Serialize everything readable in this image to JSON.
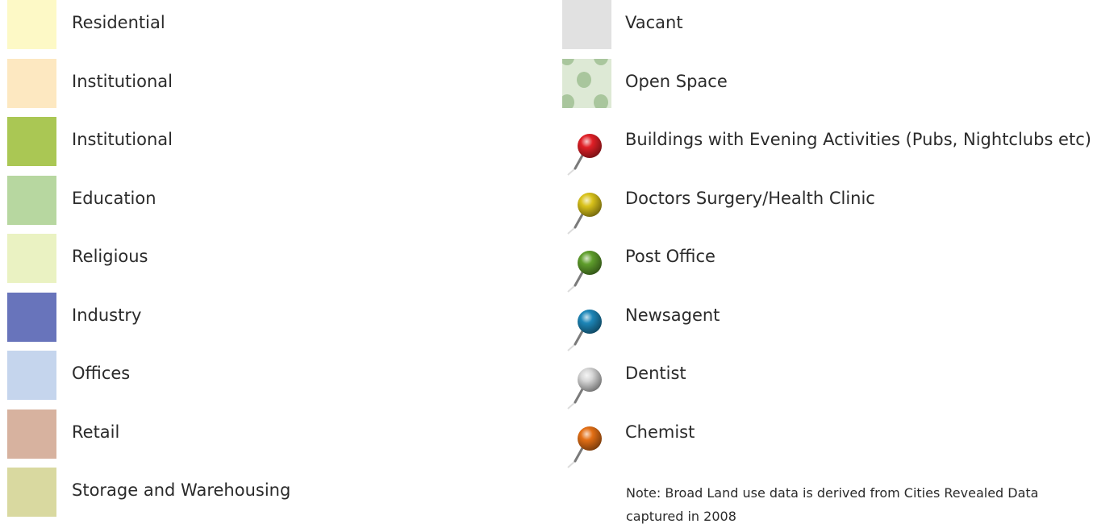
{
  "land_use": [
    {
      "label": "Residential",
      "color": "#fdf9c6"
    },
    {
      "label": "Institutional",
      "color": "#fde8c1"
    },
    {
      "label": "Institutional",
      "color": "#aac754"
    },
    {
      "label": "Education",
      "color": "#b7d7a0"
    },
    {
      "label": "Religious",
      "color": "#eaf2c2"
    },
    {
      "label": "Industry",
      "color": "#6874bb"
    },
    {
      "label": "Offices",
      "color": "#c5d5ed"
    },
    {
      "label": "Retail",
      "color": "#d7b29f"
    },
    {
      "label": "Storage and Warehousing",
      "color": "#d9d9a0"
    }
  ],
  "other": [
    {
      "label": "Vacant",
      "color": "#e1e1e1"
    },
    {
      "label": "Open Space",
      "color": "#dde9d5",
      "dot_color": "#a9c69d"
    }
  ],
  "pins": [
    {
      "label": "Buildings with Evening Activities (Pubs, Nightclubs etc)",
      "icon": "red-pin-icon",
      "color": "#e01f26"
    },
    {
      "label": "Doctors Surgery/Health Clinic",
      "icon": "yellow-pin-icon",
      "color": "#d9c21a"
    },
    {
      "label": "Post Office",
      "icon": "green-pin-icon",
      "color": "#5f9e2c"
    },
    {
      "label": "Newsagent",
      "icon": "blue-pin-icon",
      "color": "#1d86b8"
    },
    {
      "label": "Dentist",
      "icon": "white-pin-icon",
      "color": "#d6d6d6"
    },
    {
      "label": "Chemist",
      "icon": "orange-pin-icon",
      "color": "#e36f15"
    }
  ],
  "note": "Note: Broad Land use data is derived from Cities Revealed Data captured in 2008"
}
